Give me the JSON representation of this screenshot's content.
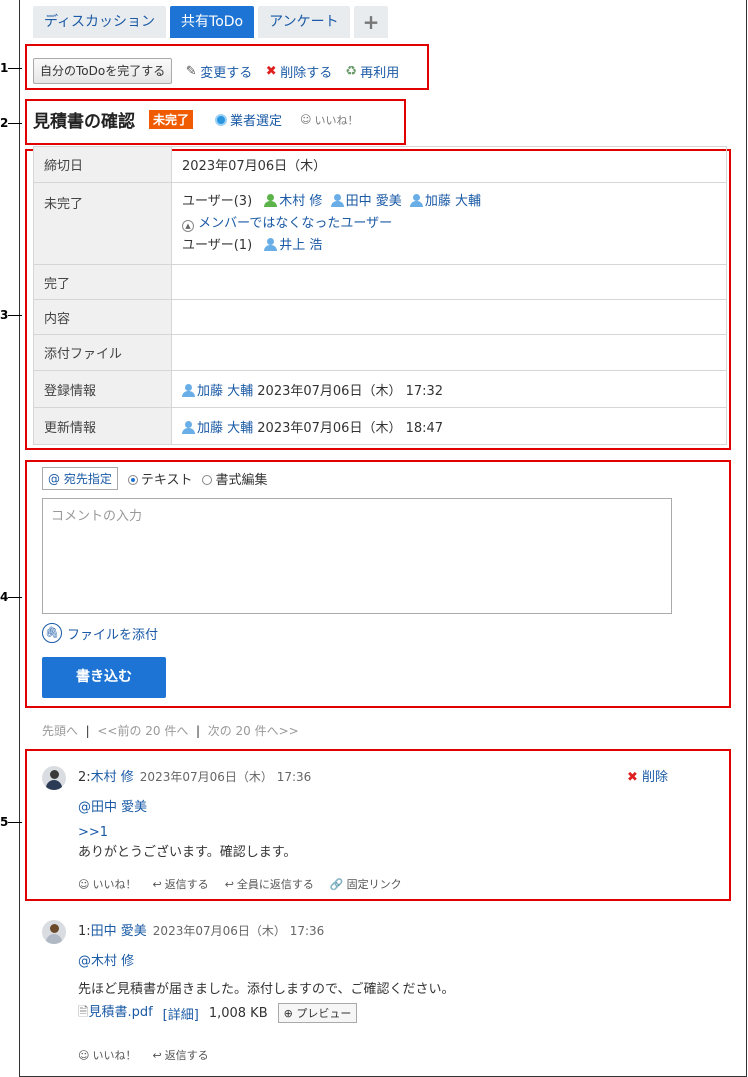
{
  "callouts": [
    "1",
    "2",
    "3",
    "4",
    "5"
  ],
  "tabs": [
    {
      "label": "ディスカッション",
      "active": false
    },
    {
      "label": "共有ToDo",
      "active": true
    },
    {
      "label": "アンケート",
      "active": false
    },
    {
      "label": "+",
      "active": false
    }
  ],
  "toolbar": {
    "complete_label": "自分のToDoを完了する",
    "edit_label": "変更する",
    "delete_label": "削除する",
    "reuse_label": "再利用"
  },
  "todo": {
    "title": "見積書の確認",
    "status_badge": "未完了",
    "category": "業者選定",
    "like_label": "いいね！"
  },
  "details": {
    "due_label": "締切日",
    "due_value": "2023年07月06日（木）",
    "incomplete_label": "未完了",
    "incomplete_group1": "ユーザー(3)",
    "incomplete_users": [
      "木村 修",
      "田中 愛美",
      "加藤 大輔"
    ],
    "non_member_label": "メンバーではなくなったユーザー",
    "incomplete_group2": "ユーザー(1)",
    "non_member_user": "井上 浩",
    "complete_label": "完了",
    "content_label": "内容",
    "attachment_label": "添付ファイル",
    "registered_label": "登録情報",
    "registered_user": "加藤 大輔",
    "registered_time": "2023年07月06日（木） 17:32",
    "updated_label": "更新情報",
    "updated_user": "加藤 大輔",
    "updated_time": "2023年07月06日（木） 18:47"
  },
  "comment_form": {
    "mention_label": "宛先指定",
    "mode_text": "テキスト",
    "mode_rich": "書式編集",
    "placeholder": "コメントの入力",
    "attach_label": "ファイルを添付",
    "submit_label": "書き込む"
  },
  "pager": {
    "first": "先頭へ",
    "prev": "<<前の 20 件へ",
    "next": "次の 20 件へ>>",
    "sep": "|"
  },
  "comments": [
    {
      "number": "2:",
      "author": "木村 修",
      "date": "2023年07月06日（木） 17:36",
      "mention": "@田中 愛美",
      "reply_ref": ">>1",
      "text": "ありがとうございます。確認します。",
      "delete_label": "削除",
      "like": "いいね！",
      "reply": "返信する",
      "reply_all": "全員に返信する",
      "permalink": "固定リンク"
    },
    {
      "number": "1:",
      "author": "田中 愛美",
      "date": "2023年07月06日（木） 17:36",
      "mention": "@木村 修",
      "text": "先ほど見積書が届きました。添付しますので、ご確認ください。",
      "file_name": "見積書.pdf",
      "file_detail": "[詳細]",
      "file_size": "1,008 KB",
      "preview": "プレビュー",
      "like": "いいね！",
      "reply": "返信する"
    }
  ],
  "colors": {
    "accent": "#1e74d4",
    "badge": "#f05a00",
    "callout_box": "#e00000",
    "link": "#1a5aa6"
  }
}
